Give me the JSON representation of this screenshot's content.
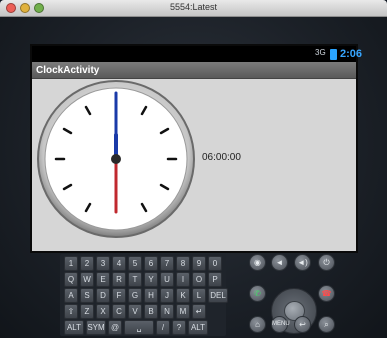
{
  "window": {
    "title": "5554:Latest"
  },
  "status_bar": {
    "signal": "3G",
    "time": "2:06"
  },
  "app": {
    "title": "ClockActivity",
    "digital_time": "06:00:00"
  },
  "keyboard": {
    "row1": [
      "1",
      "2",
      "3",
      "4",
      "5",
      "6",
      "7",
      "8",
      "9",
      "0"
    ],
    "row2": [
      "Q",
      "W",
      "E",
      "R",
      "T",
      "Y",
      "U",
      "I",
      "O",
      "P"
    ],
    "row3": [
      "A",
      "S",
      "D",
      "F",
      "G",
      "H",
      "J",
      "K",
      "L",
      "DEL"
    ],
    "row4": [
      "⇧",
      "Z",
      "X",
      "C",
      "V",
      "B",
      "N",
      "M",
      "↵"
    ],
    "row5": [
      "ALT",
      "SYM",
      "@",
      "␣",
      "/",
      "?",
      "ALT"
    ]
  },
  "controls": {
    "top": [
      "camera",
      "volume-down",
      "volume-up",
      "power"
    ],
    "bottom": [
      "home",
      "menu",
      "back",
      "search"
    ]
  },
  "colors": {
    "accent": "#37a6ff",
    "minute_hand": "#1a3aa8",
    "second_hand": "#c0282e"
  }
}
